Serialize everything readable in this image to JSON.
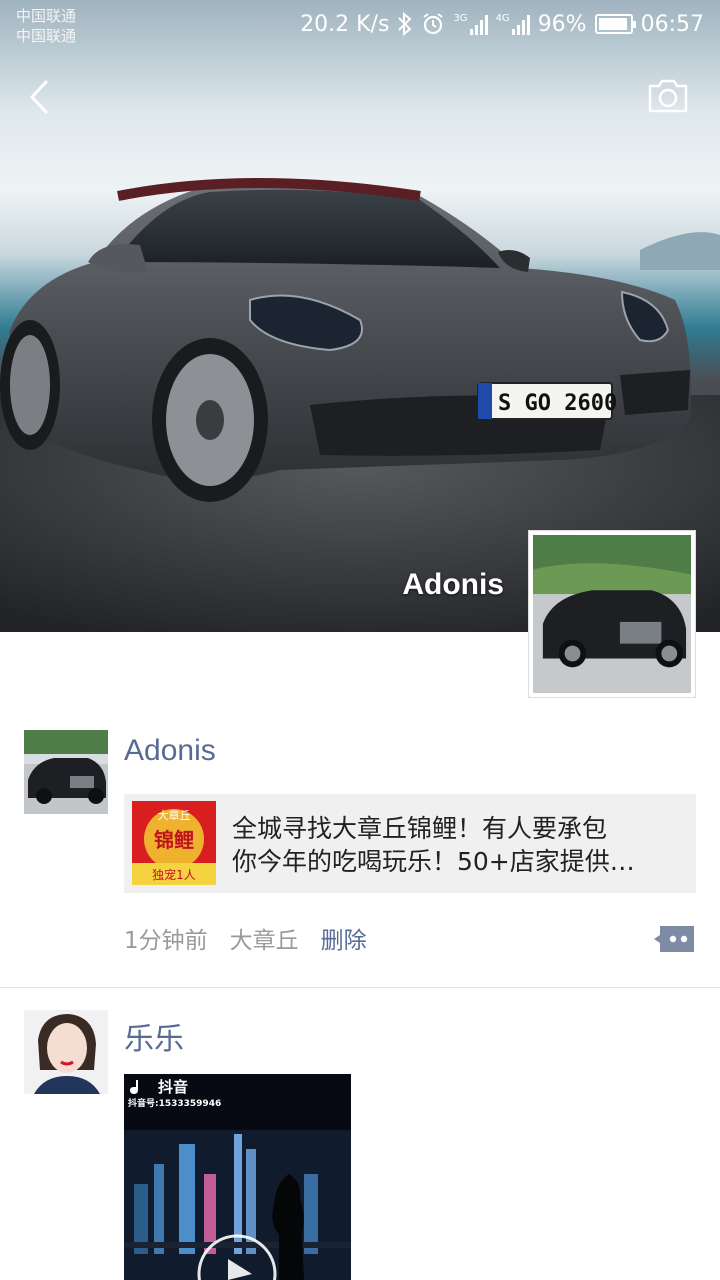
{
  "status_bar": {
    "carrier_1": "中国联通",
    "carrier_2": "中国联通",
    "net_speed": "20.2 K/s",
    "net_type_1": "3G",
    "net_type_2": "4G",
    "battery": "96%",
    "battery_level": 0.96,
    "time": "06:57"
  },
  "header": {
    "back_icon": "chevron-left-icon",
    "camera_icon": "camera-icon"
  },
  "cover": {
    "user_name": "Adonis",
    "plate": "S GO 2600"
  },
  "posts": [
    {
      "author": "Adonis",
      "link_text": "全城寻找大章丘锦鲤！有人要承包\n你今年的吃喝玩乐！50+店家提供…",
      "thumb_top": "大章丘",
      "thumb_main": "锦鲤",
      "thumb_bottom": "独宠1人",
      "time": "1分钟前",
      "location": "大章丘",
      "delete_label": "删除"
    },
    {
      "author": "乐乐",
      "video_label": "抖音",
      "video_id": "抖音号:1533359946"
    }
  ],
  "colors": {
    "link_blue": "#576b95",
    "meta_gray": "#9a9a9a",
    "card_bg": "#f0f0f0"
  }
}
